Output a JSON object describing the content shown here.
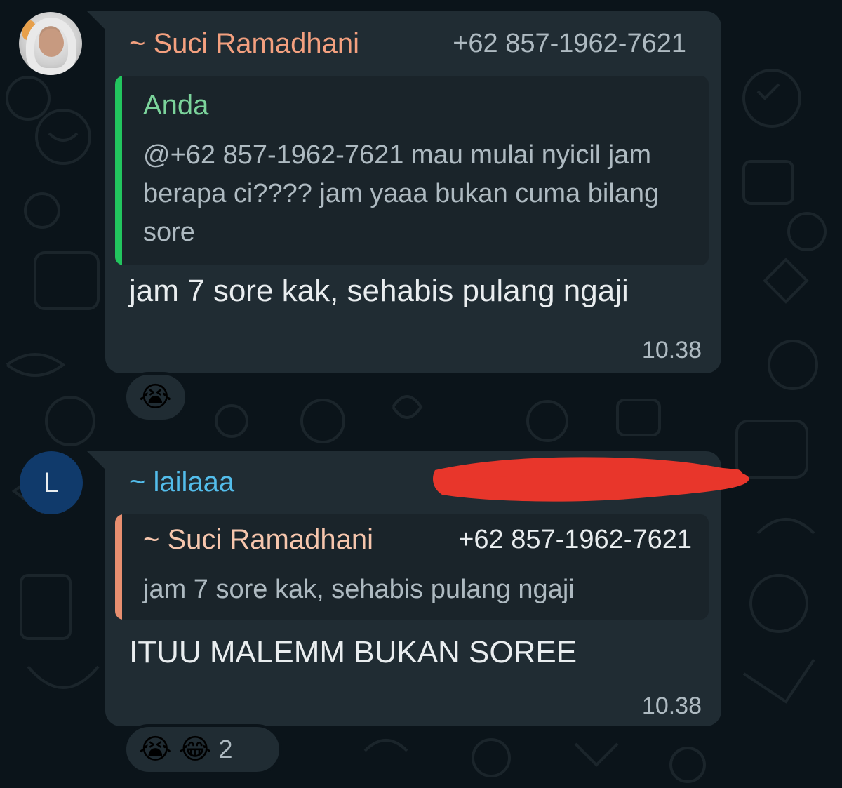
{
  "messages": [
    {
      "sender": {
        "name": "~ Suci Ramadhani",
        "phone": "+62 857-1962-7621",
        "name_color": "#f3a07f"
      },
      "quoted": {
        "author": "Anda",
        "author_color": "#7bd39b",
        "bar_color": "#22c55e",
        "text": "@+62 857-1962-7621  mau mulai nyicil jam berapa ci???? jam yaaa bukan cuma bilang sore"
      },
      "text": "jam 7 sore kak, sehabis pulang ngaji",
      "time": "10.38",
      "reactions": {
        "emojis": [
          "😭"
        ],
        "count": ""
      }
    },
    {
      "avatar_letter": "L",
      "sender": {
        "name": "~ lailaaa",
        "phone": "",
        "name_color": "#53bdeb"
      },
      "quoted": {
        "author": "~ Suci Ramadhani",
        "author_phone": "+62 857-1962-7621",
        "bar_color": "#e88f70",
        "text": "jam 7 sore kak, sehabis pulang ngaji"
      },
      "text": "ITUU MALEMM BUKAN SOREE",
      "time": "10.38",
      "reactions": {
        "emojis": [
          "😭",
          "😂"
        ],
        "count": "2"
      }
    }
  ],
  "colors": {
    "background": "#0b141a",
    "bubble": "#202c33",
    "redaction": "#e8362b"
  }
}
